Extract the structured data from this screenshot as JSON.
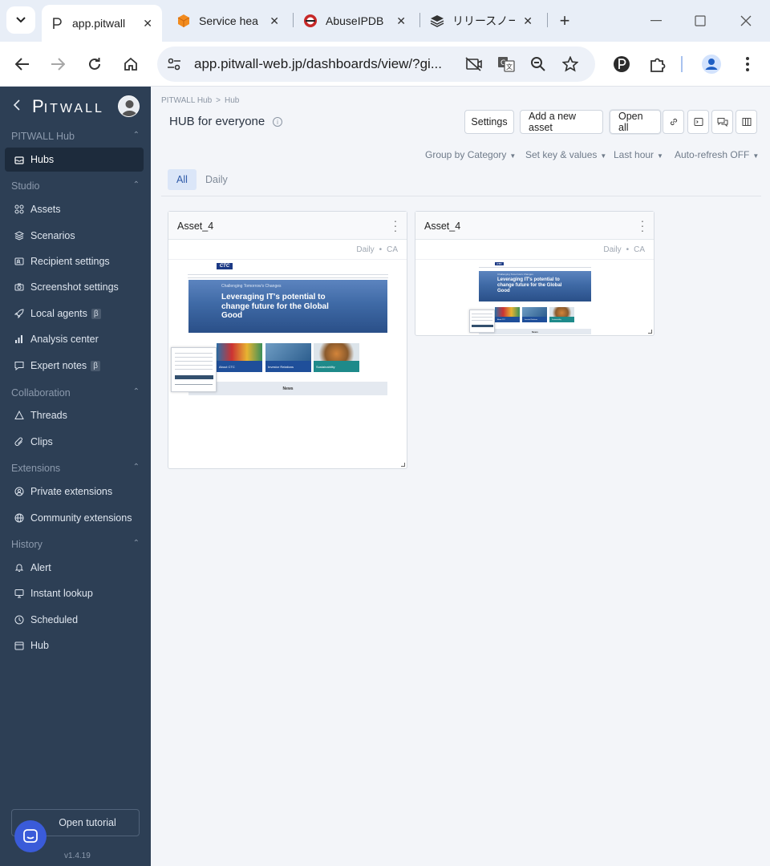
{
  "browser": {
    "tabs": [
      {
        "title": "app.pitwall",
        "active": true
      },
      {
        "title": "Service hea",
        "active": false
      },
      {
        "title": "AbuseIPDB",
        "active": false
      },
      {
        "title": "リリースノート",
        "active": false
      }
    ],
    "url": "app.pitwall-web.jp/dashboards/view/?gi...",
    "profile_initial": "P"
  },
  "sidebar": {
    "logo_p": "P",
    "logo_rest": "ITWALL",
    "sections": {
      "hub": "PITWALL Hub",
      "studio": "Studio",
      "collaboration": "Collaboration",
      "extensions": "Extensions",
      "history": "History"
    },
    "items": {
      "hubs": "Hubs",
      "assets": "Assets",
      "scenarios": "Scenarios",
      "recipient_settings": "Recipient settings",
      "screenshot_settings": "Screenshot settings",
      "local_agents": "Local agents",
      "analysis_center": "Analysis center",
      "expert_notes": "Expert notes",
      "threads": "Threads",
      "clips": "Clips",
      "private_extensions": "Private extensions",
      "community_extensions": "Community extensions",
      "alert": "Alert",
      "instant_lookup": "Instant lookup",
      "scheduled": "Scheduled",
      "hub": "Hub"
    },
    "beta": "β",
    "tutorial": "Open tutorial",
    "version": "v1.4.19"
  },
  "main": {
    "breadcrumb": {
      "root": "PITWALL Hub",
      "current": "Hub",
      "sep": ">"
    },
    "title": "HUB for everyone",
    "info": "i",
    "buttons": {
      "settings": "Settings",
      "add_asset": "Add a new asset",
      "open_all": "Open all"
    },
    "filters": {
      "group": "Group by Category",
      "keys": "Set key & values",
      "range": "Last hour",
      "refresh": "Auto-refresh OFF"
    },
    "tabs": {
      "all": "All",
      "daily": "Daily"
    },
    "cards": [
      {
        "title": "Asset_4",
        "frequency": "Daily",
        "region": "CA"
      },
      {
        "title": "Asset_4",
        "frequency": "Daily",
        "region": "CA"
      }
    ],
    "thumbnail": {
      "logo": "CTC",
      "hero_small": "Challenging Tomorrow's Changes",
      "hero_big": "Leveraging IT's potential to change future for the Global Good",
      "tiles": [
        "About CTC",
        "Investor Relations",
        "Sustainability"
      ],
      "news": "News"
    }
  },
  "colors": {
    "sidebar_bg": "#2d3f55",
    "accent": "#2f5aa8",
    "chat_button": "#3a5bd9"
  }
}
